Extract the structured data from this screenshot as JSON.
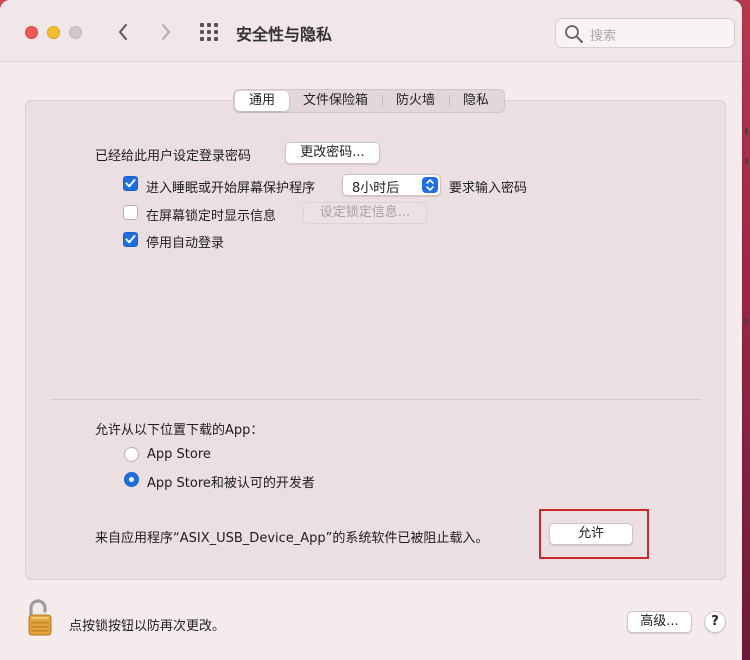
{
  "window": {
    "title": "安全性与隐私",
    "search_placeholder": "搜索"
  },
  "tabs": [
    {
      "label": "通用",
      "active": true
    },
    {
      "label": "文件保险箱",
      "active": false
    },
    {
      "label": "防火墙",
      "active": false
    },
    {
      "label": "隐私",
      "active": false
    }
  ],
  "general": {
    "password_label": "已经给此用户设定登录密码",
    "change_password_button": "更改密码...",
    "require_password_label": "进入睡眠或开始屏幕保护程序",
    "require_password_checked": true,
    "require_password_delay": "8小时后",
    "require_password_suffix": "要求输入密码",
    "show_message_label": "在屏幕锁定时显示信息",
    "show_message_checked": false,
    "set_lock_message_button": "设定锁定信息...",
    "disable_autologin_label": "停用自动登录",
    "disable_autologin_checked": true
  },
  "downloads": {
    "heading": "允许从以下位置下载的App：",
    "options": [
      {
        "label": "App Store",
        "selected": false
      },
      {
        "label": "App Store和被认可的开发者",
        "selected": true
      }
    ],
    "blocked_message": "来自应用程序“ASIX_USB_Device_App”的系统软件已被阻止载入。",
    "allow_button": "允许"
  },
  "footer": {
    "lock_text": "点按锁按钮以防再次更改。",
    "advanced_button": "高级...",
    "help_button": "?"
  },
  "colors": {
    "accent": "#1f6fe0",
    "highlight_box": "#c8282e"
  }
}
